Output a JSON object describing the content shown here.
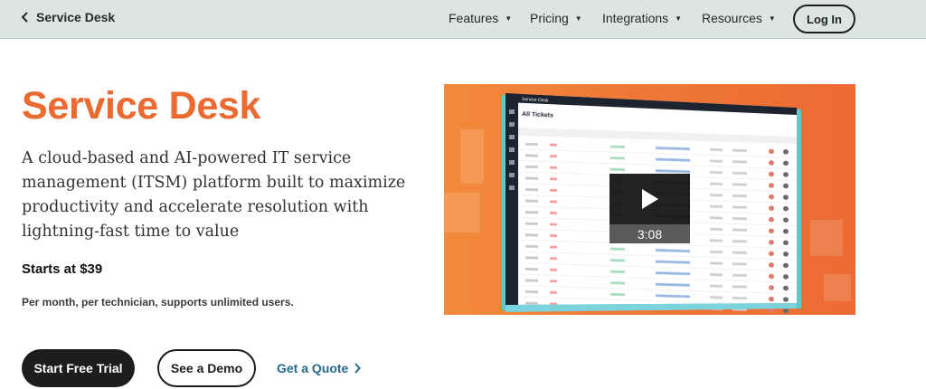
{
  "nav": {
    "back_label": "Service Desk",
    "items": [
      {
        "label": "Features"
      },
      {
        "label": "Pricing"
      },
      {
        "label": "Integrations"
      },
      {
        "label": "Resources"
      }
    ],
    "login_label": "Log In"
  },
  "hero": {
    "title": "Service Desk",
    "description": "A cloud-based and AI-powered IT service management (ITSM) platform built to maximize productivity and accelerate resolution with lightning-fast time to value",
    "price": "Starts at $39",
    "price_note": "Per month, per technician, supports unlimited users."
  },
  "cta": {
    "trial_label": "Start Free Trial",
    "demo_label": "See a Demo",
    "quote_label": "Get a Quote"
  },
  "video": {
    "duration": "3:08",
    "screen_app_title": "Service Desk",
    "screen_view_title": "All Tickets"
  },
  "colors": {
    "brand_orange": "#ea6a32",
    "link_blue": "#236a8c",
    "nav_bg": "#dde5e3"
  }
}
